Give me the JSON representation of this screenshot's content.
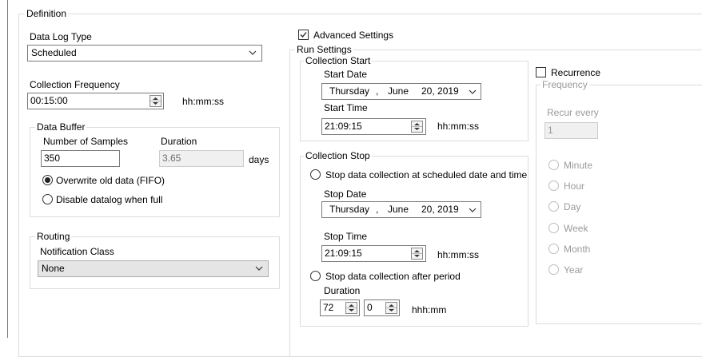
{
  "definition": {
    "title": "Definition"
  },
  "data_log_type": {
    "label": "Data Log Type",
    "value": "Scheduled"
  },
  "collection_frequency": {
    "label": "Collection Frequency",
    "value": "00:15:00",
    "unit": "hh:mm:ss"
  },
  "data_buffer": {
    "title": "Data Buffer",
    "samples_label": "Number of Samples",
    "samples_value": "350",
    "duration_label": "Duration",
    "duration_value": "3.65",
    "duration_unit": "days",
    "option_overwrite": "Overwrite old data (FIFO)",
    "option_disable": "Disable datalog when full"
  },
  "routing": {
    "title": "Routing",
    "notification_label": "Notification Class",
    "notification_value": "None"
  },
  "advanced_settings": {
    "label": "Advanced Settings",
    "checked": true
  },
  "run_settings": {
    "title": "Run Settings"
  },
  "collection_start": {
    "title": "Collection Start",
    "start_date_label": "Start Date",
    "date": {
      "weekday": "Thursday",
      "sep": ",",
      "month": "June",
      "day_year": "20, 2019"
    },
    "start_time_label": "Start Time",
    "start_time_value": "21:09:15",
    "time_unit": "hh:mm:ss"
  },
  "collection_stop": {
    "title": "Collection Stop",
    "option_scheduled": "Stop data collection at scheduled date and time",
    "stop_date_label": "Stop Date",
    "date": {
      "weekday": "Thursday",
      "sep": ",",
      "month": "June",
      "day_year": "20, 2019"
    },
    "stop_time_label": "Stop Time",
    "stop_time_value": "21:09:15",
    "time_unit": "hh:mm:ss",
    "option_period": "Stop data collection after period",
    "duration_label": "Duration",
    "hours_value": "72",
    "minutes_value": "0",
    "duration_unit": "hhh:mm"
  },
  "recurrence": {
    "label": "Recurrence",
    "checked": false,
    "frequency_title": "Frequency",
    "recur_every_label": "Recur every",
    "recur_every_value": "1",
    "options": [
      "Minute",
      "Hour",
      "Day",
      "Week",
      "Month",
      "Year"
    ]
  }
}
